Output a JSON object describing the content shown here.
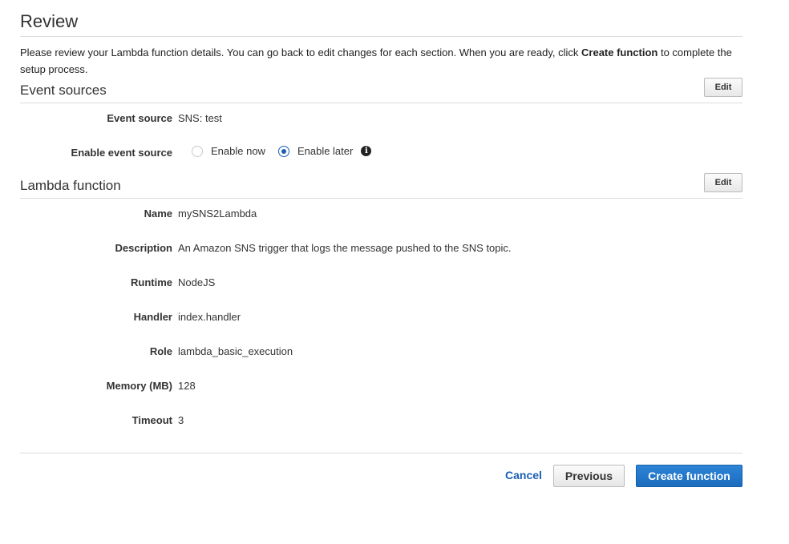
{
  "header": {
    "title": "Review"
  },
  "intro": {
    "text_before": "Please review your Lambda function details. You can go back to edit changes for each section. When you are ready, click ",
    "bold": "Create function",
    "text_after": " to complete the setup process."
  },
  "event_sources": {
    "title": "Event sources",
    "edit_label": "Edit",
    "event_source_label": "Event source",
    "event_source_value": "SNS: test",
    "enable_label": "Enable event source",
    "options": [
      {
        "label": "Enable now",
        "checked": false
      },
      {
        "label": "Enable later",
        "checked": true
      }
    ],
    "info_icon": "i"
  },
  "lambda_function": {
    "title": "Lambda function",
    "edit_label": "Edit",
    "fields": [
      {
        "label": "Name",
        "value": "mySNS2Lambda"
      },
      {
        "label": "Description",
        "value": "An Amazon SNS trigger that logs the message pushed to the SNS topic."
      },
      {
        "label": "Runtime",
        "value": "NodeJS"
      },
      {
        "label": "Handler",
        "value": "index.handler"
      },
      {
        "label": "Role",
        "value": "lambda_basic_execution"
      },
      {
        "label": "Memory (MB)",
        "value": "128"
      },
      {
        "label": "Timeout",
        "value": "3"
      }
    ]
  },
  "footer": {
    "cancel_label": "Cancel",
    "previous_label": "Previous",
    "create_label": "Create function"
  },
  "colors": {
    "primary": "#1a5fb4",
    "primary_button": "#2379c9",
    "rule": "#dddddd"
  }
}
